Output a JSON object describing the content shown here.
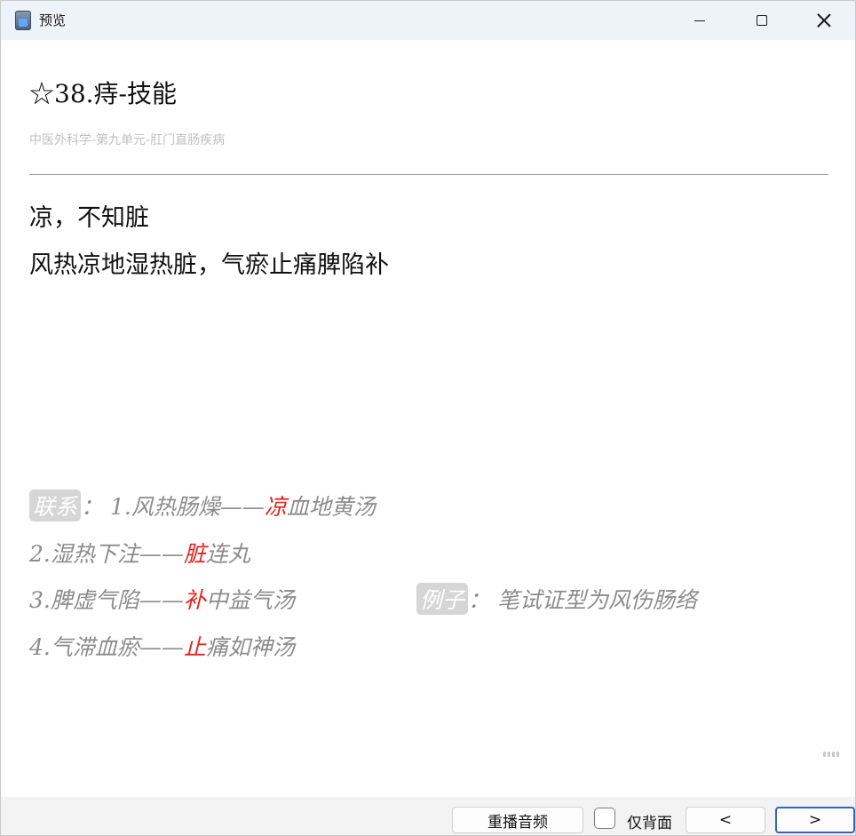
{
  "window": {
    "title": "预览",
    "icon": "app-icon"
  },
  "card": {
    "title": "☆38.痔-技能",
    "breadcrumb": "中医外科学-第九单元-肛门直肠疾病",
    "mnemonic_line1": "凉，不知脏",
    "mnemonic_line2": "风热凉地湿热脏，气瘀止痛脾陷补"
  },
  "notes": {
    "link_tag": "联系",
    "example_tag": "例子",
    "sep": "：",
    "items": [
      {
        "prefix": "1.风热肠燥——",
        "key": "凉",
        "suffix": "血地黄汤"
      },
      {
        "prefix": "2.湿热下注——",
        "key": "脏",
        "suffix": "连丸"
      },
      {
        "prefix": "3.脾虚气陷——",
        "key": "补",
        "suffix": "中益气汤"
      },
      {
        "prefix": "4.气滞血瘀——",
        "key": "止",
        "suffix": "痛如神汤"
      }
    ],
    "example_text": "笔试证型为风伤肠络",
    "key_color": "#e8211d"
  },
  "bottom": {
    "replay_label": "重播音频",
    "back_only_label": "仅背面",
    "back_only_checked": false,
    "prev_label": "<",
    "next_label": ">"
  }
}
